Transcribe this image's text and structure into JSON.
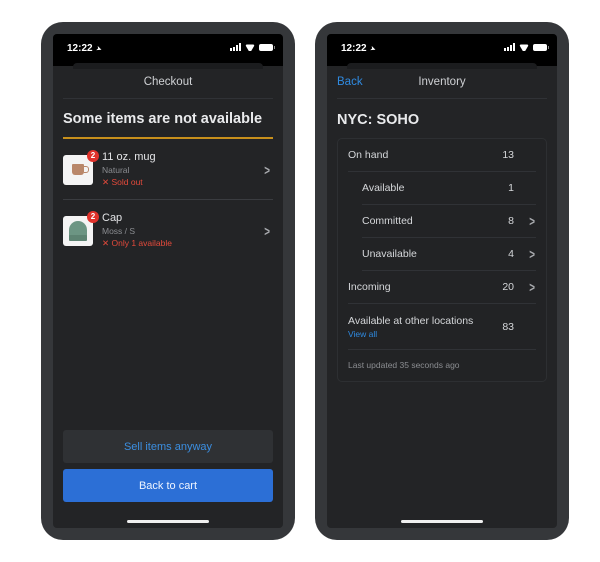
{
  "status_bar": {
    "time": "12:22",
    "location_icon": "location-arrow-icon"
  },
  "checkout": {
    "nav_title": "Checkout",
    "heading": "Some items are not available",
    "items": [
      {
        "name": "11 oz. mug",
        "variant": "Natural",
        "status": "✕ Sold out",
        "badge": "2",
        "icon": "mug-icon"
      },
      {
        "name": "Cap",
        "variant": "Moss / S",
        "status": "✕ Only 1 available",
        "badge": "2",
        "icon": "beanie-icon"
      }
    ],
    "secondary_button": "Sell items anyway",
    "primary_button": "Back to cart"
  },
  "inventory": {
    "back_label": "Back",
    "nav_title": "Inventory",
    "location": "NYC: SOHO",
    "rows": [
      {
        "label": "On hand",
        "value": "13",
        "chevron": false,
        "indent": false
      },
      {
        "label": "Available",
        "value": "1",
        "chevron": false,
        "indent": true
      },
      {
        "label": "Committed",
        "value": "8",
        "chevron": true,
        "indent": true
      },
      {
        "label": "Unavailable",
        "value": "4",
        "chevron": true,
        "indent": true
      },
      {
        "label": "Incoming",
        "value": "20",
        "chevron": true,
        "indent": false
      }
    ],
    "other_locations": {
      "label": "Available at other locations",
      "link": "View all",
      "value": "83"
    },
    "last_updated": "Last updated 35 seconds ago"
  },
  "colors": {
    "accent_blue": "#2c6fd6",
    "link_blue": "#2f8ae0",
    "warning_underline": "#c8901c",
    "error_red": "#e34a3b",
    "screen_bg": "#232426"
  }
}
